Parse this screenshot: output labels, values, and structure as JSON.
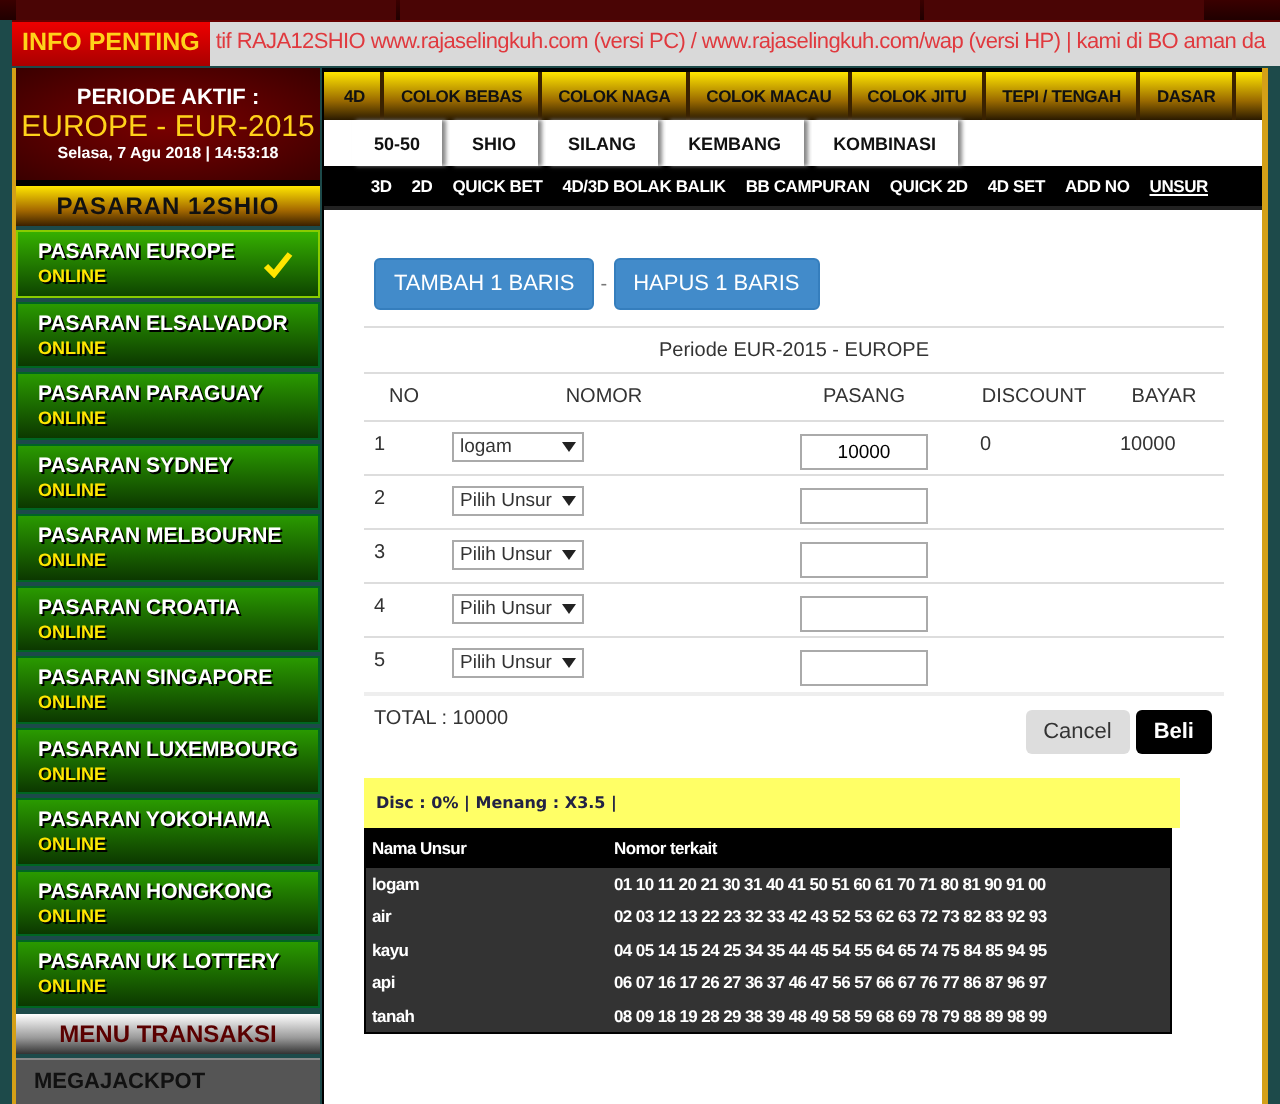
{
  "info": {
    "label": "INFO PENTING",
    "text": "tif RAJA12SHIO www.rajaselingkuh.com (versi PC) / www.rajaselingkuh.com/wap (versi HP) | kami di BO aman da"
  },
  "period": {
    "label": "PERIODE AKTIF :",
    "name": "EUROPE - EUR-2015",
    "date": "Selasa, 7 Agu 2018 | 14:53:18"
  },
  "sidebar": {
    "header": "PASARAN 12SHIO",
    "markets": [
      {
        "name": "PASARAN EUROPE",
        "status": "ONLINE",
        "selected": true
      },
      {
        "name": "PASARAN ELSALVADOR",
        "status": "ONLINE",
        "selected": false
      },
      {
        "name": "PASARAN PARAGUAY",
        "status": "ONLINE",
        "selected": false
      },
      {
        "name": "PASARAN SYDNEY",
        "status": "ONLINE",
        "selected": false
      },
      {
        "name": "PASARAN MELBOURNE",
        "status": "ONLINE",
        "selected": false
      },
      {
        "name": "PASARAN CROATIA",
        "status": "ONLINE",
        "selected": false
      },
      {
        "name": "PASARAN SINGAPORE",
        "status": "ONLINE",
        "selected": false
      },
      {
        "name": "PASARAN LUXEMBOURG",
        "status": "ONLINE",
        "selected": false
      },
      {
        "name": "PASARAN YOKOHAMA",
        "status": "ONLINE",
        "selected": false
      },
      {
        "name": "PASARAN HONGKONG",
        "status": "ONLINE",
        "selected": false
      },
      {
        "name": "PASARAN UK LOTTERY",
        "status": "ONLINE",
        "selected": false
      }
    ],
    "menu_header": "MENU TRANSAKSI",
    "menu_items": [
      "MEGAJACKPOT"
    ]
  },
  "main_menu": [
    {
      "label": "4D",
      "selected": false
    },
    {
      "label": "COLOK BEBAS",
      "selected": false
    },
    {
      "label": "COLOK NAGA",
      "selected": false
    },
    {
      "label": "COLOK MACAU",
      "selected": false
    },
    {
      "label": "COLOK JITU",
      "selected": false
    },
    {
      "label": "TEPI / TENGAH",
      "selected": false
    },
    {
      "label": "DASAR",
      "selected": false
    }
  ],
  "game_tabs": [
    {
      "label": "50-50"
    },
    {
      "label": "SHIO"
    },
    {
      "label": "SILANG"
    },
    {
      "label": "KEMBANG"
    },
    {
      "label": "KOMBINASI"
    }
  ],
  "bet_tabs": [
    {
      "label": "3D",
      "selected": false
    },
    {
      "label": "2D",
      "selected": false
    },
    {
      "label": "QUICK BET",
      "selected": false
    },
    {
      "label": "4D/3D BOLAK BALIK",
      "selected": false
    },
    {
      "label": "BB CAMPURAN",
      "selected": false
    },
    {
      "label": "QUICK 2D",
      "selected": false
    },
    {
      "label": "4D SET",
      "selected": false
    },
    {
      "label": "ADD NO",
      "selected": false
    },
    {
      "label": "UNSUR",
      "selected": true
    }
  ],
  "form": {
    "add_button": "TAMBAH 1 BARIS",
    "separator": "-",
    "remove_button": "HAPUS 1 BARIS",
    "title": "Periode EUR-2015 - EUROPE",
    "columns": [
      "NO",
      "NOMOR",
      "PASANG",
      "DISCOUNT",
      "BAYAR"
    ],
    "rows": [
      {
        "no": "1",
        "unsur": "logam",
        "pasang": "10000",
        "discount": "0",
        "bayar": "10000"
      },
      {
        "no": "2",
        "unsur": "Pilih Unsur"
      },
      {
        "no": "3",
        "unsur": "Pilih Unsur"
      },
      {
        "no": "4",
        "unsur": "Pilih Unsur"
      },
      {
        "no": "5",
        "unsur": "Pilih Unsur"
      }
    ],
    "total": "TOTAL : 10000",
    "cancel_button": "Cancel",
    "buy_button": "Beli"
  },
  "odds": "Disc : 0% | Menang : X3.5 |",
  "elements": {
    "columns": [
      "Nama Unsur",
      "Nomor terkait"
    ],
    "rows": [
      {
        "name": "logam",
        "numbers": "01 10 11 20 21 30 31 40 41 50 51 60 61 70 71 80 81 90 91 00"
      },
      {
        "name": "air",
        "numbers": "02 03 12 13 22 23 32 33 42 43 52 53 62 63 72 73 82 83 92 93"
      },
      {
        "name": "kayu",
        "numbers": "04 05 14 15 24 25 34 35 44 45 54 55 64 65 74 75 84 85 94 95"
      },
      {
        "name": "api",
        "numbers": "06 07 16 17 26 27 36 37 46 47 56 57 66 67 76 77 86 87 96 97"
      },
      {
        "name": "tanah",
        "numbers": "08 09 18 19 28 29 38 39 48 49 58 59 68 69 78 79 88 89 98 99"
      }
    ]
  }
}
